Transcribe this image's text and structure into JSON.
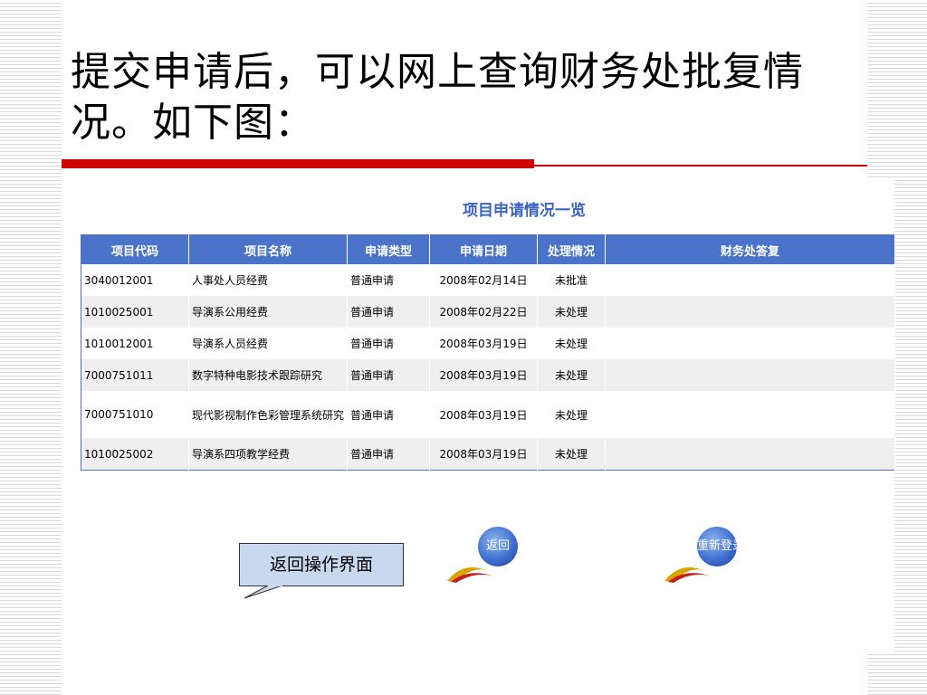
{
  "slide": {
    "title": "提交申请后，可以网上查询财务处批复情况。如下图："
  },
  "table": {
    "title": "项目申请情况一览",
    "headers": [
      "项目代码",
      "项目名称",
      "申请类型",
      "申请日期",
      "处理情况",
      "财务处答复"
    ],
    "rows": [
      [
        "3040012001",
        "人事处人员经费",
        "普通申请",
        "2008年02月14日",
        "未批准",
        ""
      ],
      [
        "1010025001",
        "导演系公用经费",
        "普通申请",
        "2008年02月22日",
        "未处理",
        ""
      ],
      [
        "1010012001",
        "导演系人员经费",
        "普通申请",
        "2008年03月19日",
        "未处理",
        ""
      ],
      [
        "7000751011",
        "数字特种电影技术跟踪研究",
        "普通申请",
        "2008年03月19日",
        "未处理",
        ""
      ],
      [
        "7000751010",
        "现代影视制作色彩管理系统研究",
        "普通申请",
        "2008年03月19日",
        "未处理",
        ""
      ],
      [
        "1010025002",
        "导演系四项教学经费",
        "普通申请",
        "2008年03月19日",
        "未处理",
        ""
      ]
    ]
  },
  "buttons": {
    "back_label": "返回",
    "relogin_label": "重新登录"
  },
  "callout": {
    "text": "返回操作界面"
  },
  "colors": {
    "header_bg": "#4a73c9",
    "title_color": "#3a63c4",
    "divider": "#cc0000",
    "callout_bg": "#c8d8ef"
  }
}
